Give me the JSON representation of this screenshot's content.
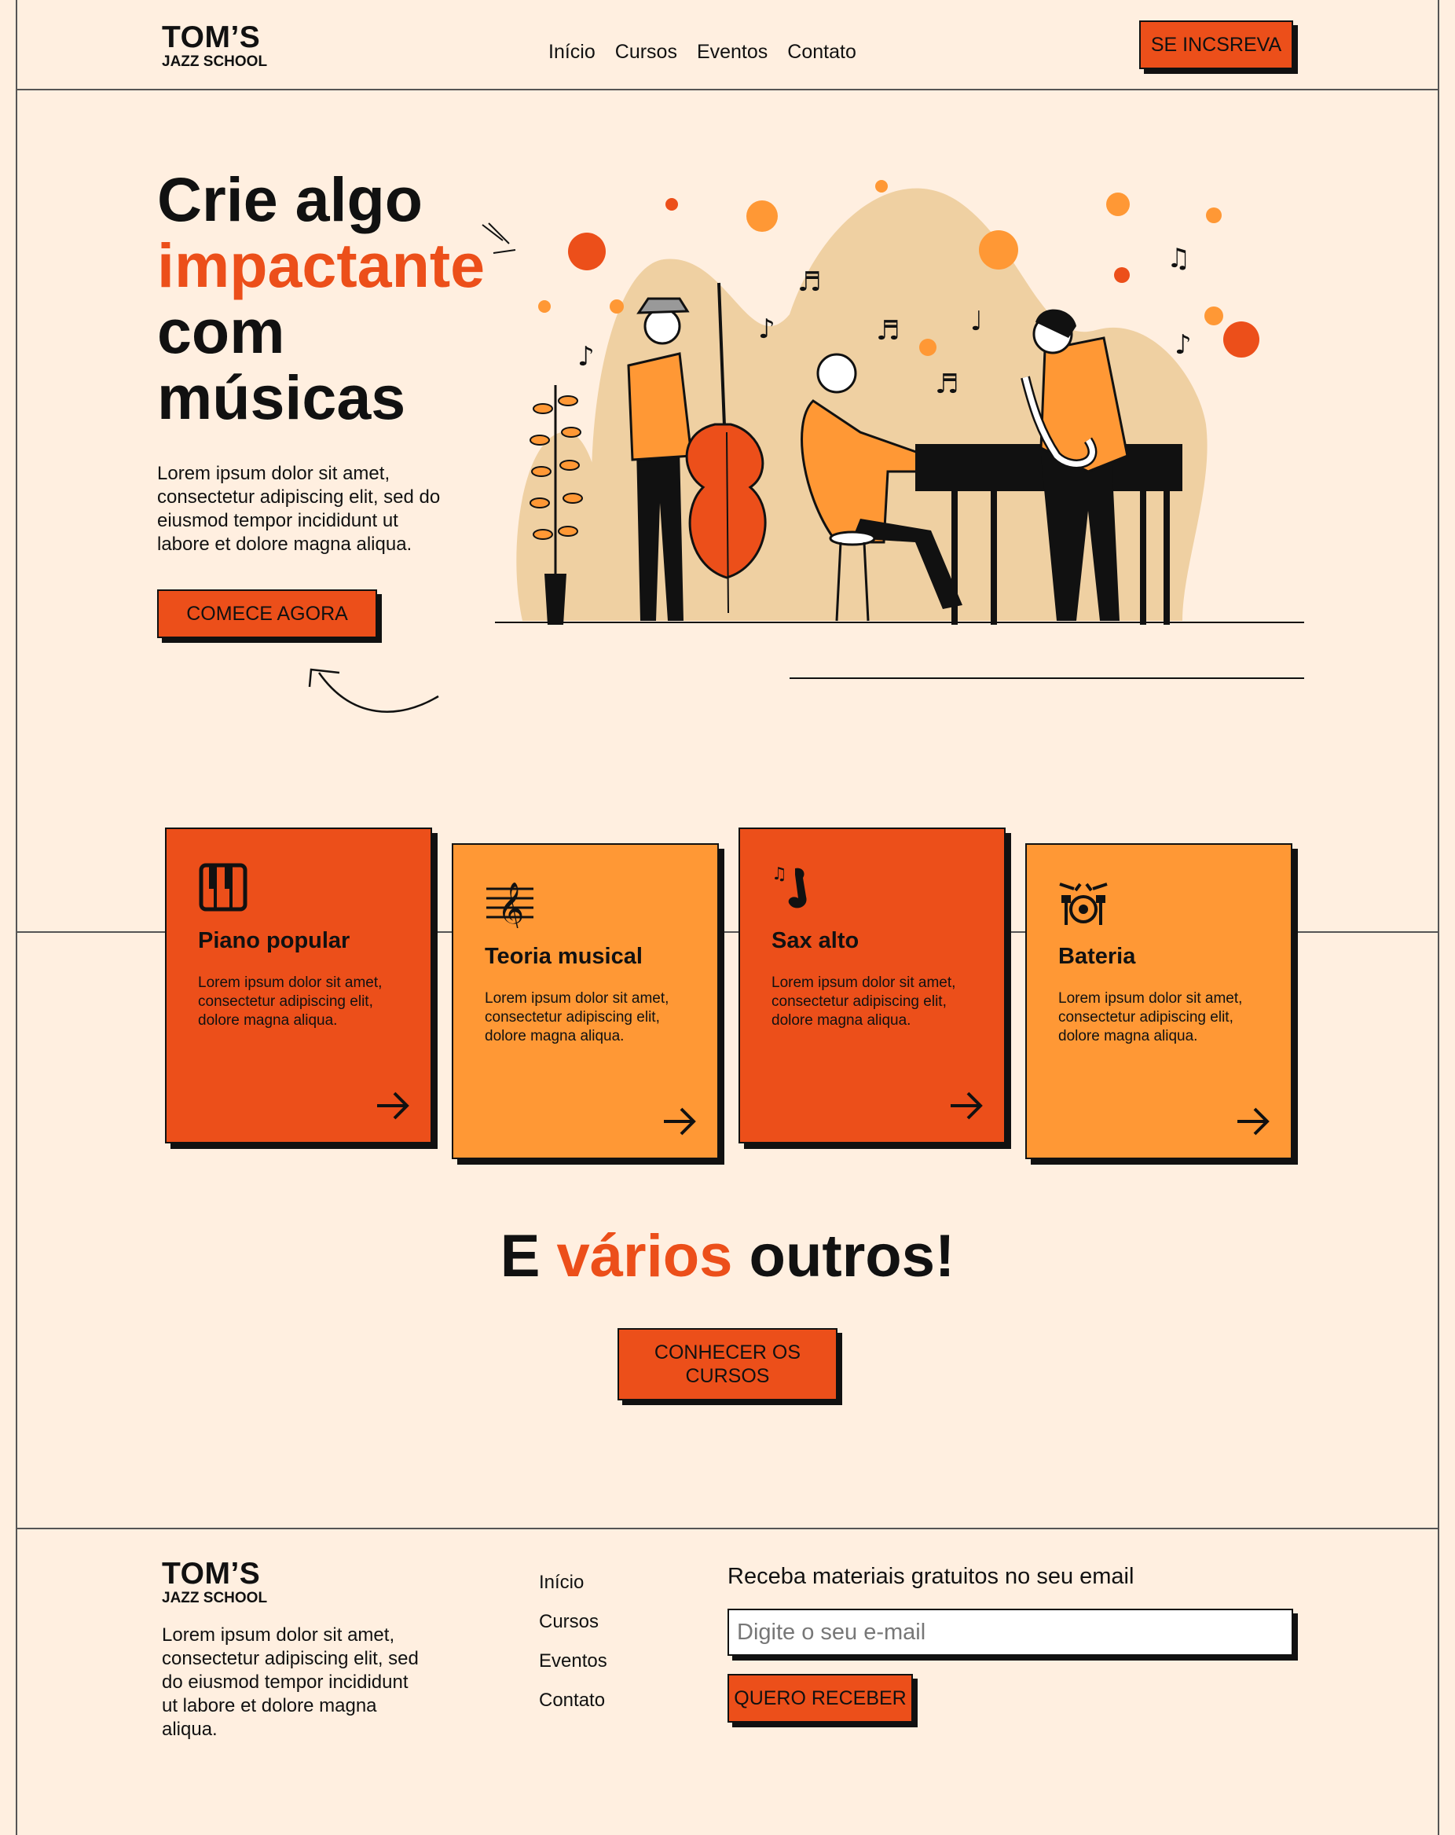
{
  "colors": {
    "background": "#ffefe0",
    "accent": "#ec4f1a",
    "orange": "#ff9835",
    "ink": "#111111"
  },
  "header": {
    "logo_title": "TOM’S",
    "logo_subtitle": "JAZZ SCHOOL",
    "nav": [
      "Início",
      "Cursos",
      "Eventos",
      "Contato"
    ],
    "cta": "SE INCSREVA"
  },
  "hero": {
    "title_line1": "Crie algo",
    "title_accent": "impactante",
    "title_line3": "com",
    "title_line4": "músicas",
    "text": "Lorem ipsum dolor sit amet, consectetur adipiscing elit, sed do eiusmod tempor incididunt ut labore et dolore magna aliqua.",
    "cta": "COMECE AGORA",
    "illustration": "jazz-band-illustration"
  },
  "courses": [
    {
      "title": "Piano popular",
      "text": "Lorem ipsum dolor sit amet, consectetur adipiscing elit, dolore magna aliqua.",
      "icon": "piano-keys-icon",
      "color": "#ec4f1a"
    },
    {
      "title": "Teoria musical",
      "text": "Lorem ipsum dolor sit amet, consectetur adipiscing elit, dolore magna aliqua.",
      "icon": "treble-clef-icon",
      "color": "#ff9835"
    },
    {
      "title": "Sax alto",
      "text": "Lorem ipsum dolor sit amet, consectetur adipiscing elit, dolore magna aliqua.",
      "icon": "saxophone-icon",
      "color": "#ec4f1a"
    },
    {
      "title": "Bateria",
      "text": "Lorem ipsum dolor sit amet, consectetur adipiscing elit, dolore magna aliqua.",
      "icon": "drum-kit-icon",
      "color": "#ff9835"
    }
  ],
  "others": {
    "part1": "E ",
    "accent": "vários",
    "part2": " outros!",
    "cta": "CONHECER OS CURSOS"
  },
  "footer": {
    "logo_title": "TOM’S",
    "logo_subtitle": "JAZZ SCHOOL",
    "text": "Lorem ipsum dolor sit amet, consectetur adipiscing elit, sed do eiusmod tempor incididunt ut labore et dolore magna aliqua.",
    "nav": [
      "Início",
      "Cursos",
      "Eventos",
      "Contato"
    ],
    "newsletter_title": "Receba materiais gratuitos no seu email",
    "email_placeholder": "Digite o seu e-mail",
    "cta": "QUERO RECEBER"
  }
}
